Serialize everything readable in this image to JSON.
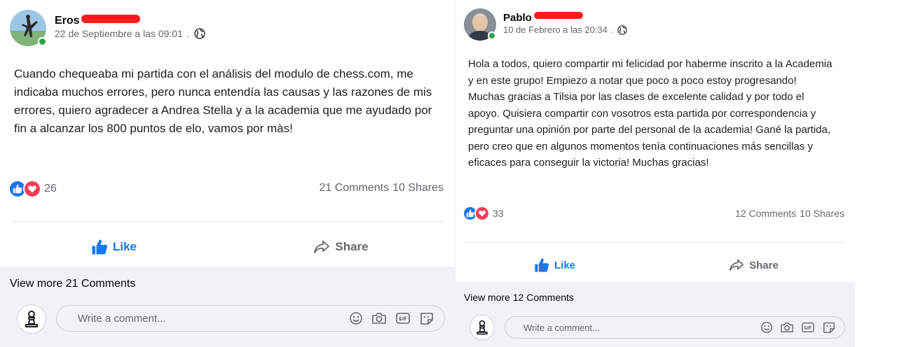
{
  "posts": [
    {
      "author": "Eros",
      "timestamp": "22 de Septiembre a las 09:01",
      "separator": ".",
      "body": "Cuando chequeaba mi partida con el análisis del modulo de chess.com, me indicaba muchos errores, pero nunca entendía las causas y las razones de mis errores, quiero agradecer a Andrea Stella y a la academia que me ayudado por fin a alcanzar los 800 puntos de elo, vamos por màs!",
      "reaction_count": "26",
      "comments_label": "21 Comments",
      "shares_label": "10 Shares",
      "like_label": "Like",
      "share_label": "Share",
      "view_more": "View more 21 Comments",
      "comment_placeholder": "Write a comment..."
    },
    {
      "author": "Pablo",
      "timestamp": "10 de Febrero a las 20:34",
      "separator": ".",
      "body": "Hola a todos, quiero compartir mi felicidad por haberme inscrito a la Academia y en este grupo! Empiezo a notar que poco a poco estoy progresando! Muchas gracias a Tilsia por las clases de excelente calidad y por todo el apoyo. Quisiera compartir con vosotros esta partida por correspondencia y preguntar una opinión por parte del personal de la academia! Gané la partida, pero creo que en algunos momentos tenía continuaciones más sencillas y eficaces para conseguir la victoria! Muchas gracias!",
      "reaction_count": "33",
      "comments_label": "12 Comments",
      "shares_label": "10 Shares",
      "like_label": "Like",
      "share_label": "Share",
      "view_more": "View more 12 Comments",
      "comment_placeholder": "Write a comment..."
    }
  ],
  "colors": {
    "accent": "#1877f2",
    "love": "#f33e58",
    "online": "#31a24c",
    "redaction": "#ff1a1a",
    "muted": "#65676b"
  },
  "icons": [
    "globe-icon",
    "like-reaction-icon",
    "love-reaction-icon",
    "thumbs-up-icon",
    "share-arrow-icon",
    "pawn-icon",
    "emoji-icon",
    "camera-icon",
    "gif-icon",
    "sticker-icon"
  ]
}
